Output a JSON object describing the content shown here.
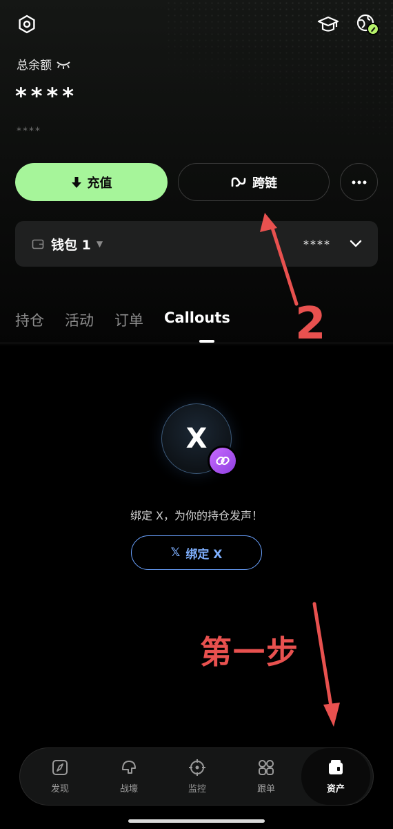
{
  "colors": {
    "accent_green": "#a6f59a",
    "link_blue": "#7fb0ff",
    "annotation_red": "#e8514f",
    "badge_purple": "#b35cf5"
  },
  "header": {
    "icons": [
      "settings-icon",
      "academy-cap-icon",
      "globe-profile-icon"
    ]
  },
  "balance": {
    "label": "总余额",
    "value": "****",
    "sub_value": "****"
  },
  "actions": {
    "deposit_label": "充值",
    "bridge_label": "跨链",
    "more_icon": "ellipsis-icon"
  },
  "wallet": {
    "name": "钱包 1",
    "amount": "****"
  },
  "tabs": [
    {
      "label": "持仓",
      "active": false
    },
    {
      "label": "活动",
      "active": false
    },
    {
      "label": "订单",
      "active": false
    },
    {
      "label": "Callouts",
      "active": true
    }
  ],
  "callouts": {
    "x_glyph": "X",
    "message": "绑定 X，为你的持仓发声！",
    "bind_button_label": "绑定 X",
    "bind_button_glyph": "𝕏"
  },
  "annotations": {
    "marker_2": "2",
    "step_one": "第一步"
  },
  "bottom_nav": [
    {
      "label": "发现",
      "icon": "compass-icon",
      "active": false
    },
    {
      "label": "战壕",
      "icon": "helmet-icon",
      "active": false
    },
    {
      "label": "监控",
      "icon": "crosshair-icon",
      "active": false
    },
    {
      "label": "跟单",
      "icon": "grid-circles-icon",
      "active": false
    },
    {
      "label": "资产",
      "icon": "wallet-icon",
      "active": true
    }
  ]
}
